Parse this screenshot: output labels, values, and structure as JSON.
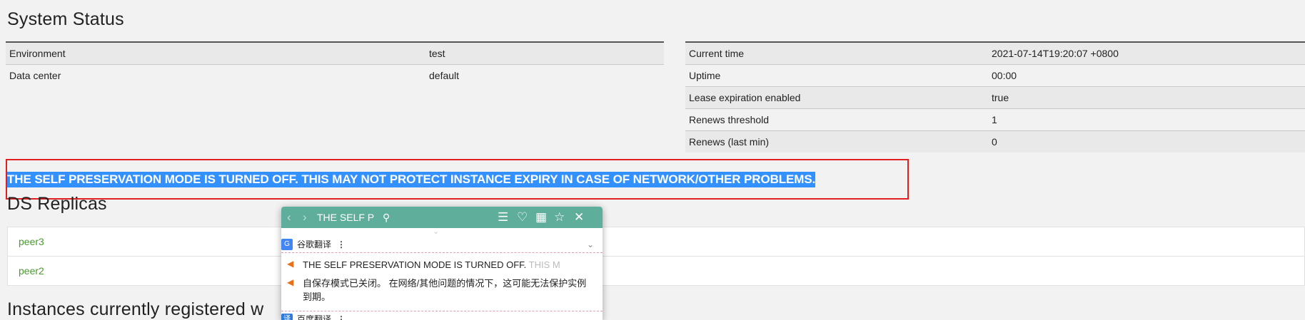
{
  "system_status": {
    "title": "System Status",
    "left_table": [
      {
        "label": "Environment",
        "value": "test"
      },
      {
        "label": "Data center",
        "value": "default"
      }
    ],
    "right_table": [
      {
        "label": "Current time",
        "value": "2021-07-14T19:20:07 +0800"
      },
      {
        "label": "Uptime",
        "value": "00:00"
      },
      {
        "label": "Lease expiration enabled",
        "value": "true"
      },
      {
        "label": "Renews threshold",
        "value": "1"
      },
      {
        "label": "Renews (last min)",
        "value": "0"
      }
    ]
  },
  "warning": "THE SELF PRESERVATION MODE IS TURNED OFF. THIS MAY NOT PROTECT INSTANCE EXPIRY IN CASE OF NETWORK/OTHER PROBLEMS.",
  "ds_replicas": {
    "title": "DS Replicas",
    "items": [
      "peer3",
      "peer2"
    ]
  },
  "instances_title": "Instances currently registered w",
  "translate_popup": {
    "query": "THE SELF PI",
    "engine1": {
      "name": "谷歌翻译",
      "more": "⋮"
    },
    "source_line_main": "THE SELF PRESERVATION MODE IS TURNED OFF.",
    "source_line_fade": " THIS M",
    "translated": "自保存模式已关闭。 在网络/其他问题的情况下，这可能无法保护实例到期。",
    "engine2": {
      "name": "百度翻译",
      "more": "⋮",
      "logo": "译"
    },
    "icons": [
      "back-icon",
      "forward-icon",
      "search-icon",
      "menu-icon",
      "heart-icon",
      "dictionary-icon",
      "pin-icon",
      "close-icon"
    ]
  }
}
